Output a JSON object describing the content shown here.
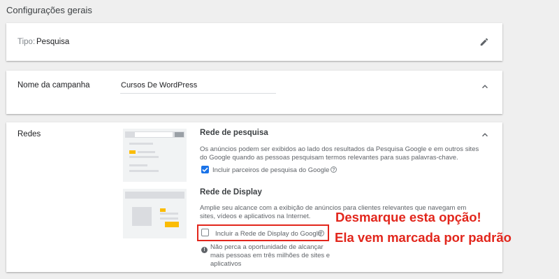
{
  "page_title": "Configurações gerais",
  "type_card": {
    "label": "Tipo:",
    "value": "Pesquisa"
  },
  "campaign_card": {
    "label": "Nome da campanha",
    "value": "Cursos De WordPress"
  },
  "networks_card": {
    "label": "Redes",
    "search": {
      "title": "Rede de pesquisa",
      "description": "Os anúncios podem ser exibidos ao lado dos resultados da Pesquisa Google e em outros sites do Google quando as pessoas pesquisam termos relevantes para suas palavras-chave.",
      "checkbox_label": "Incluir parceiros de pesquisa do Google",
      "checked": true
    },
    "display": {
      "title": "Rede de Display",
      "description": "Amplie seu alcance com a exibição de anúncios para clientes relevantes que navegam em sites, vídeos e aplicativos na Internet.",
      "checkbox_label": "Incluir a Rede de Display do Google",
      "checked": false,
      "note": "Não perca a oportunidade de alcançar mais pessoas em três milhões de sites e aplicativos"
    }
  },
  "annotation": {
    "line1": "Desmarque esta opção!",
    "line2": "Ela vem marcada por padrão"
  },
  "colors": {
    "accent": "#1a73e8",
    "annotation": "#e2261c",
    "background": "#efefef"
  }
}
